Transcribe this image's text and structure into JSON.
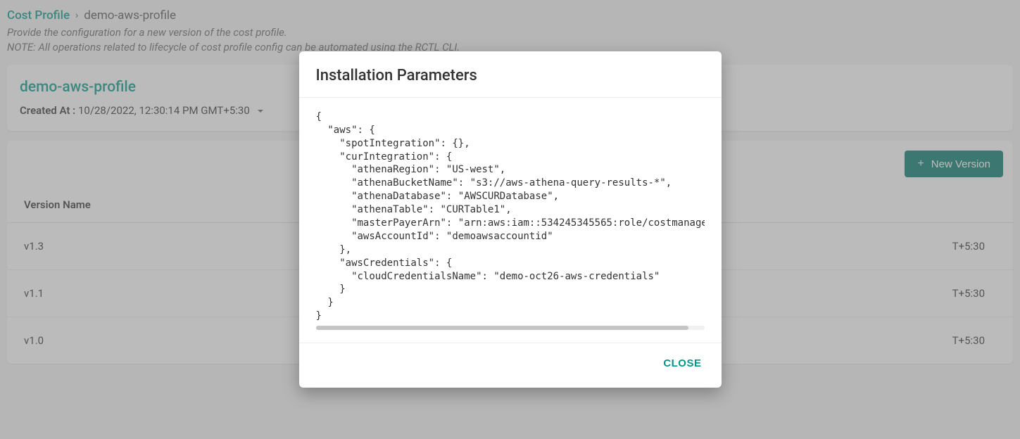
{
  "breadcrumb": {
    "root": "Cost Profile",
    "separator": "›",
    "current": "demo-aws-profile"
  },
  "subtitle": {
    "line1": "Provide the configuration for a new version of the cost profile.",
    "line2": "NOTE: All operations related to lifecycle of cost profile config can be automated using the RCTL CLI."
  },
  "profile": {
    "name": "demo-aws-profile",
    "created_at_label": "Created At :",
    "created_at_value": "10/28/2022, 12:30:14 PM GMT+5:30"
  },
  "toolbar": {
    "new_version_label": "New Version"
  },
  "table": {
    "header_version": "Version Name",
    "rows": [
      {
        "version": "v1.3",
        "ts_suffix": "T+5:30"
      },
      {
        "version": "v1.1",
        "ts_suffix": "T+5:30"
      },
      {
        "version": "v1.0",
        "ts_suffix": "T+5:30"
      }
    ]
  },
  "modal": {
    "title": "Installation Parameters",
    "json_text": "{\n  \"aws\": {\n    \"spotIntegration\": {},\n    \"curIntegration\": {\n      \"athenaRegion\": \"US-west\",\n      \"athenaBucketName\": \"s3://aws-athena-query-results-*\",\n      \"athenaDatabase\": \"AWSCURDatabase\",\n      \"athenaTable\": \"CURTable1\",\n      \"masterPayerArn\": \"arn:aws:iam::534245345565:role/costmanagementrol\n      \"awsAccountId\": \"demoawsaccountid\"\n    },\n    \"awsCredentials\": {\n      \"cloudCredentialsName\": \"demo-oct26-aws-credentials\"\n    }\n  }\n}",
    "close_label": "CLOSE"
  }
}
